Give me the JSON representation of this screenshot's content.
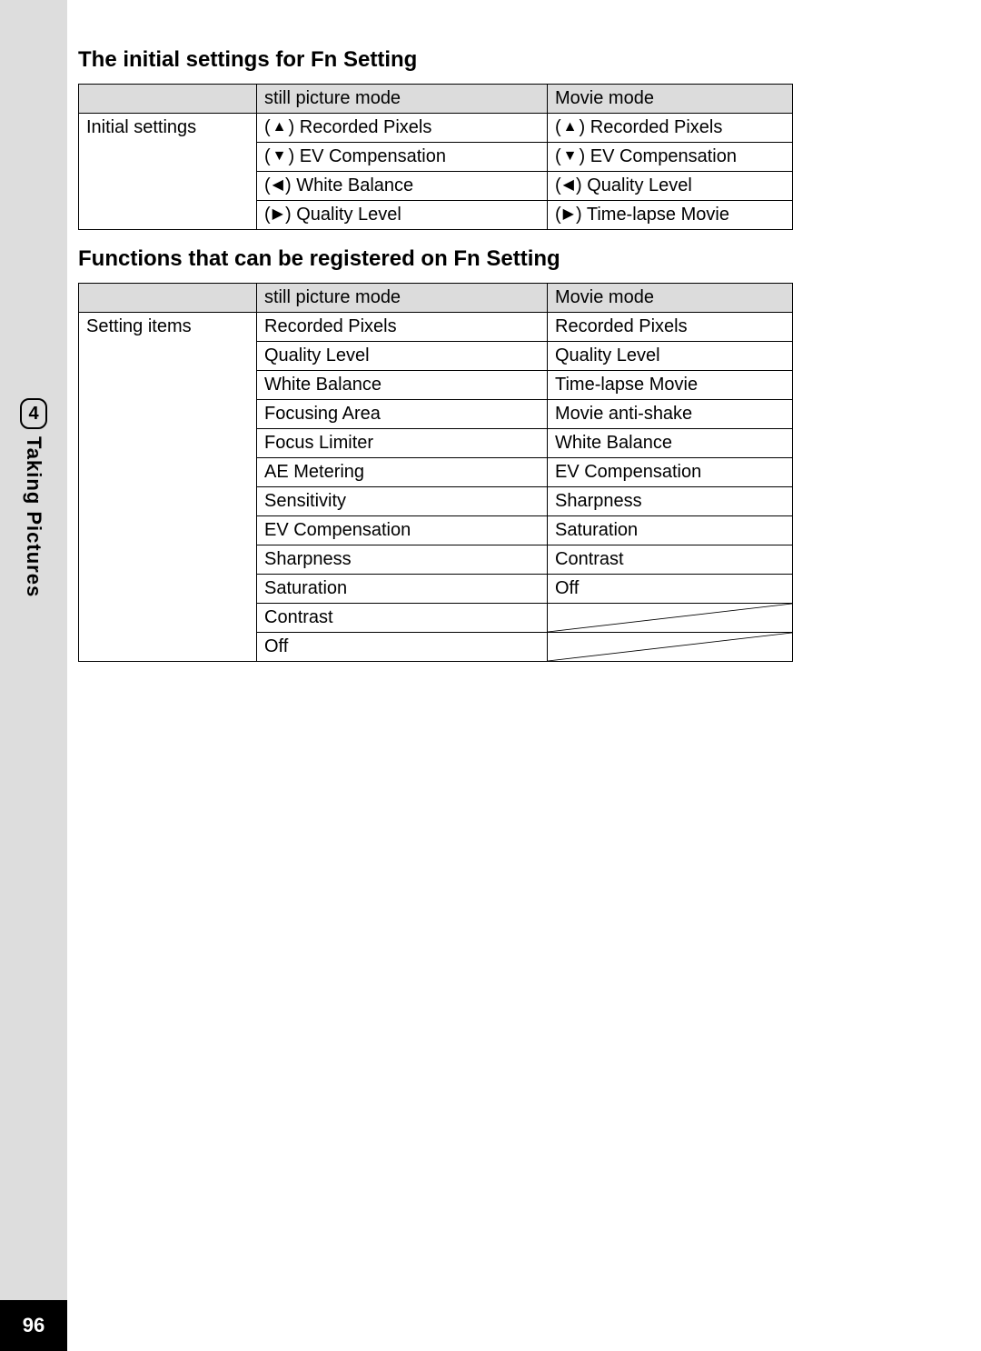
{
  "page": {
    "number": "96",
    "chapter_number": "4",
    "chapter_title": "Taking Pictures"
  },
  "heading1": "The initial settings for Fn Setting",
  "heading2": "Functions that can be registered on Fn Setting",
  "table1": {
    "header": {
      "blank": "",
      "col2": "still picture mode",
      "col3": "Movie mode"
    },
    "rowlabel": "Initial settings",
    "rows": [
      {
        "still_arrow": "▲",
        "still_text": "Recorded Pixels",
        "movie_arrow": "▲",
        "movie_text": "Recorded Pixels"
      },
      {
        "still_arrow": "▼",
        "still_text": "EV Compensation",
        "movie_arrow": "▼",
        "movie_text": "EV Compensation"
      },
      {
        "still_arrow": "◀",
        "still_text": "White Balance",
        "movie_arrow": "◀",
        "movie_text": "Quality Level"
      },
      {
        "still_arrow": "▶",
        "still_text": "Quality Level",
        "movie_arrow": "▶",
        "movie_text": "Time-lapse Movie"
      }
    ]
  },
  "table2": {
    "header": {
      "blank": "",
      "col2": "still picture mode",
      "col3": "Movie mode"
    },
    "rowlabel": "Setting items",
    "rows": [
      {
        "still": "Recorded Pixels",
        "movie": "Recorded Pixels"
      },
      {
        "still": "Quality Level",
        "movie": "Quality Level"
      },
      {
        "still": "White Balance",
        "movie": "Time-lapse Movie"
      },
      {
        "still": "Focusing Area",
        "movie": "Movie anti-shake"
      },
      {
        "still": "Focus Limiter",
        "movie": "White Balance"
      },
      {
        "still": "AE Metering",
        "movie": "EV Compensation"
      },
      {
        "still": "Sensitivity",
        "movie": "Sharpness"
      },
      {
        "still": "EV Compensation",
        "movie": "Saturation"
      },
      {
        "still": "Sharpness",
        "movie": "Contrast"
      },
      {
        "still": "Saturation",
        "movie": "Off"
      },
      {
        "still": "Contrast",
        "movie_empty": true
      },
      {
        "still": "Off",
        "movie_empty": true
      }
    ]
  }
}
